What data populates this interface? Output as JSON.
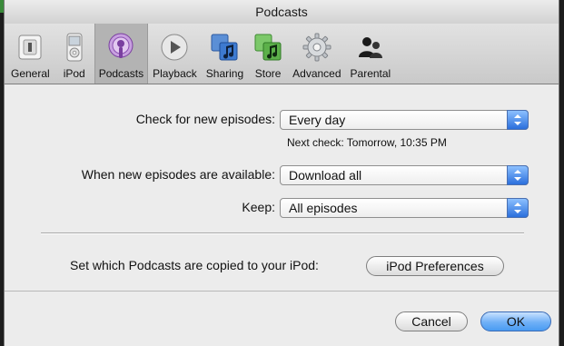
{
  "window": {
    "title": "Podcasts"
  },
  "toolbar": {
    "items": [
      {
        "label": "General",
        "icon": "general-switch-icon"
      },
      {
        "label": "iPod",
        "icon": "ipod-icon"
      },
      {
        "label": "Podcasts",
        "icon": "podcast-icon",
        "selected": true
      },
      {
        "label": "Playback",
        "icon": "play-icon"
      },
      {
        "label": "Sharing",
        "icon": "sharing-icon"
      },
      {
        "label": "Store",
        "icon": "store-icon"
      },
      {
        "label": "Advanced",
        "icon": "gear-icon"
      },
      {
        "label": "Parental",
        "icon": "parental-icon"
      }
    ]
  },
  "settings": {
    "check_label": "Check for new episodes:",
    "check_value": "Every day",
    "next_check": "Next check: Tomorrow, 10:35 PM",
    "available_label": "When new episodes are available:",
    "available_value": "Download all",
    "keep_label": "Keep:",
    "keep_value": "All episodes",
    "copy_label": "Set which Podcasts are copied to your iPod:",
    "ipod_prefs_button": "iPod Preferences"
  },
  "buttons": {
    "cancel": "Cancel",
    "ok": "OK"
  },
  "colors": {
    "accent_blue": "#4a9bf2",
    "selected_bg": "#b3b3b3"
  }
}
